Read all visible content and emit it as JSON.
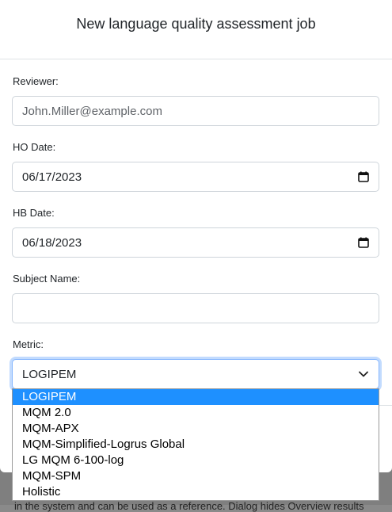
{
  "modal": {
    "title": "New language quality assessment job"
  },
  "form": {
    "reviewer": {
      "label": "Reviewer:",
      "value": "John.Miller@example.com"
    },
    "ho_date": {
      "label": "HO Date:",
      "value": "06/17/2023"
    },
    "hb_date": {
      "label": "HB Date:",
      "value": "06/18/2023"
    },
    "subject_name": {
      "label": "Subject Name:",
      "value": ""
    },
    "metric": {
      "label": "Metric:",
      "value": "LOGIPEM",
      "options": [
        "LOGIPEM",
        "MQM 2.0",
        "MQM-APX",
        "MQM-Simplified-Logrus Global",
        "LG MQM 6-100-log",
        "MQM-SPM",
        "Holistic"
      ],
      "highlighted_index": 0
    }
  },
  "icons": {
    "calendar": "calendar-icon",
    "chevron": "chevron-down-icon"
  },
  "colors": {
    "highlight": "#1e90ff",
    "focus_border": "#86b7fe"
  },
  "backdrop": {
    "text": "in the system and can be used as a reference. Dialog hides Overview results"
  }
}
